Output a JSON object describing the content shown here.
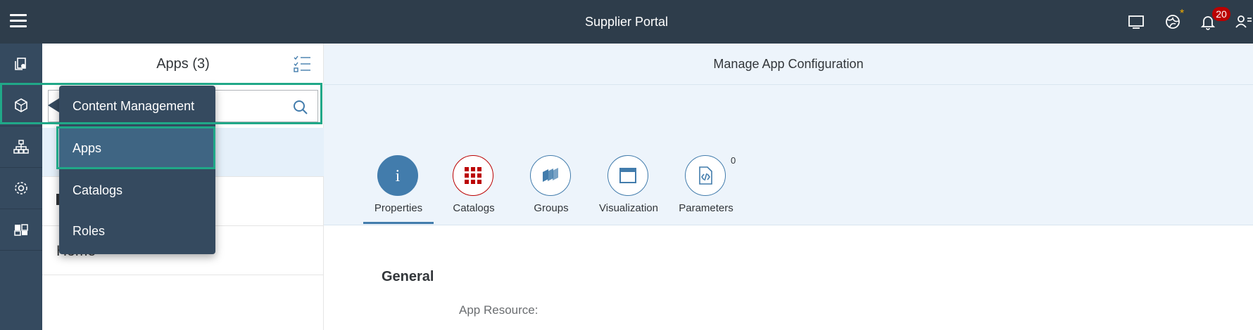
{
  "shell": {
    "title": "Supplier Portal",
    "notification_count": "20",
    "star": "*"
  },
  "sidenav": {
    "items": [
      {
        "name": "content-copy",
        "icon": "pages-icon"
      },
      {
        "name": "content-management",
        "icon": "cube-icon"
      },
      {
        "name": "site-structure",
        "icon": "hierarchy-icon"
      },
      {
        "name": "settings",
        "icon": "gear-icon"
      },
      {
        "name": "extensions",
        "icon": "puzzle-icon"
      }
    ]
  },
  "master": {
    "title": "Apps (3)",
    "search_placeholder": "",
    "items": [
      {
        "label": ""
      },
      {
        "label": ""
      },
      {
        "label": "Home"
      }
    ]
  },
  "popover": {
    "header": "Content Management",
    "items": [
      {
        "label": "Apps",
        "selected": true
      },
      {
        "label": "Catalogs",
        "selected": false
      },
      {
        "label": "Roles",
        "selected": false
      }
    ]
  },
  "detail": {
    "title": "Manage App Configuration",
    "tabs": [
      {
        "label": "Properties",
        "icon": "info-icon",
        "active": true
      },
      {
        "label": "Catalogs",
        "icon": "grid-icon",
        "active": false
      },
      {
        "label": "Groups",
        "icon": "groups-icon",
        "active": false
      },
      {
        "label": "Visualization",
        "icon": "window-icon",
        "active": false
      },
      {
        "label": "Parameters",
        "icon": "code-file-icon",
        "active": false,
        "count": "0"
      }
    ],
    "section_title": "General",
    "field_label": "App Resource:"
  },
  "colors": {
    "shellbar": "#2e3d4b",
    "sidenav": "#354a5f",
    "accent": "#427cac",
    "highlight": "#20a888",
    "badge": "#bb0000"
  }
}
